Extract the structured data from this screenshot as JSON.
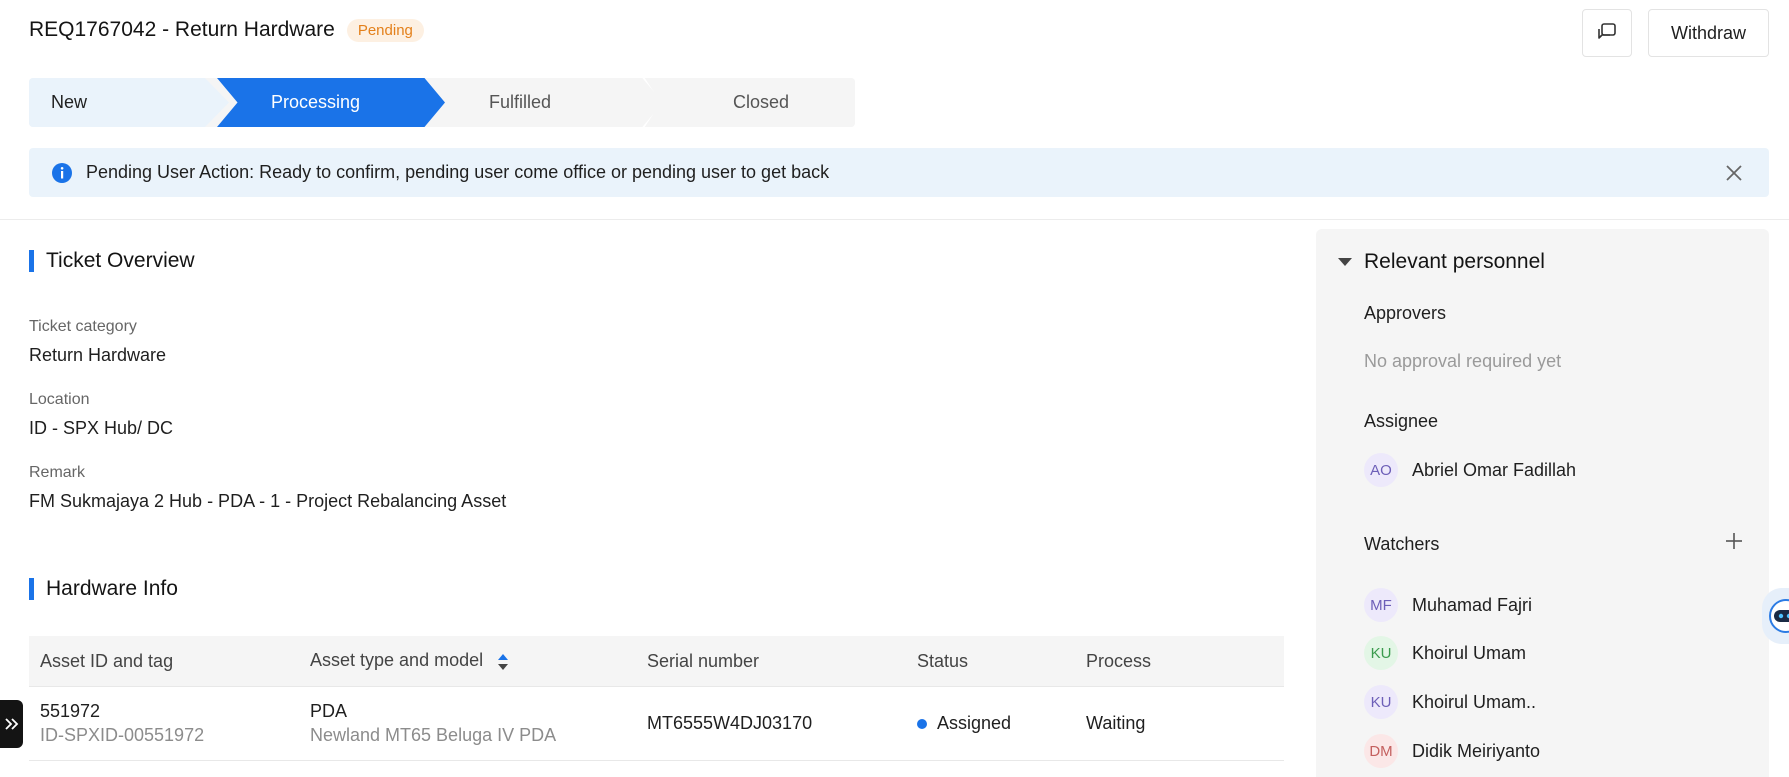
{
  "header": {
    "title": "REQ1767042 - Return Hardware",
    "badge": "Pending",
    "withdraw_label": "Withdraw",
    "comment_icon": "comment-icon"
  },
  "stepper": {
    "steps": [
      "New",
      "Processing",
      "Fulfilled",
      "Closed"
    ],
    "active": "Processing"
  },
  "alert": {
    "icon": "info-icon",
    "text": "Pending User Action: Ready to confirm, pending user come office or pending user to get back",
    "close_icon": "close-icon"
  },
  "overview": {
    "title": "Ticket Overview",
    "fields": [
      {
        "label": "Ticket category",
        "value": "Return Hardware"
      },
      {
        "label": "Location",
        "value": "ID - SPX Hub/ DC"
      },
      {
        "label": "Remark",
        "value": "FM Sukmajaya 2 Hub - PDA - 1 - Project Rebalancing Asset"
      }
    ]
  },
  "hardware": {
    "title": "Hardware Info",
    "columns": [
      "Asset ID and tag",
      "Asset type and model",
      "Serial number",
      "Status",
      "Process"
    ],
    "rows": [
      {
        "asset_id": "551972",
        "asset_tag": "ID-SPXID-00551972",
        "type": "PDA",
        "model": "Newland MT65 Beluga IV PDA",
        "serial": "MT6555W4DJ03170",
        "status": "Assigned",
        "process": "Waiting"
      }
    ]
  },
  "personnel": {
    "title": "Relevant personnel",
    "approvers_label": "Approvers",
    "approvers_empty": "No approval required yet",
    "assignee_label": "Assignee",
    "assignee": {
      "initials": "AO",
      "name": "Abriel Omar Fadillah"
    },
    "watchers_label": "Watchers",
    "watchers": [
      {
        "initials": "MF",
        "name": "Muhamad Fajri"
      },
      {
        "initials": "KU",
        "name": "Khoirul Umam"
      },
      {
        "initials": "KU",
        "name": "Khoirul Umam.."
      },
      {
        "initials": "DM",
        "name": "Didik Meiriyanto"
      }
    ]
  },
  "colors": {
    "accent": "#1a73e8",
    "pending": "#e3801b",
    "info_bg": "#eaf3fb"
  }
}
